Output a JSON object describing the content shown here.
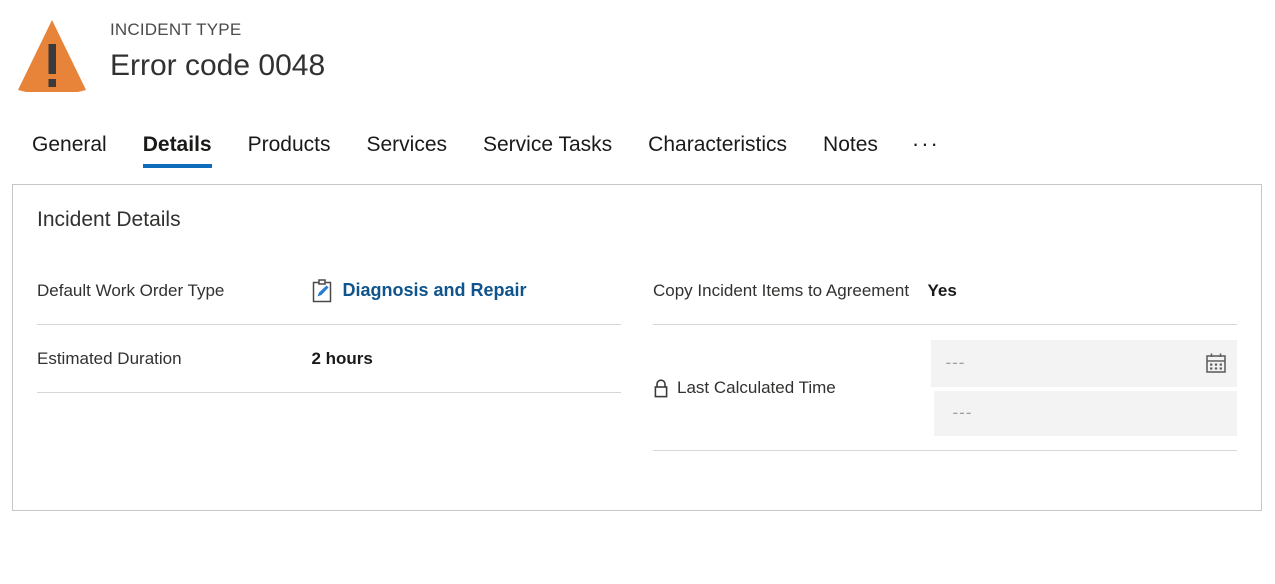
{
  "header": {
    "entity_label": "INCIDENT TYPE",
    "record_title": "Error code 0048",
    "icon": "warning-triangle-icon",
    "icon_color": "#E8833A"
  },
  "tabs": {
    "items": [
      {
        "label": "General",
        "active": false
      },
      {
        "label": "Details",
        "active": true
      },
      {
        "label": "Products",
        "active": false
      },
      {
        "label": "Services",
        "active": false
      },
      {
        "label": "Service Tasks",
        "active": false
      },
      {
        "label": "Characteristics",
        "active": false
      },
      {
        "label": "Notes",
        "active": false
      }
    ],
    "overflow_label": "···",
    "active_underline_color": "#0f6cbd"
  },
  "card": {
    "section_title": "Incident Details",
    "left_fields": [
      {
        "label": "Default Work Order Type",
        "value": "Diagnosis and Repair",
        "value_type": "lookup",
        "icon": "work-order-type-icon",
        "link_color": "#0f548c"
      },
      {
        "label": "Estimated Duration",
        "value": "2 hours",
        "value_type": "text"
      }
    ],
    "right_fields": [
      {
        "label": "Copy Incident Items to Agreement",
        "value": "Yes",
        "value_type": "text"
      },
      {
        "label": "Last Calculated Time",
        "value_type": "datetime-disabled",
        "locked": true,
        "lock_icon": "lock-icon",
        "date_placeholder": "---",
        "time_placeholder": "---",
        "calendar_icon": "calendar-icon"
      }
    ]
  }
}
